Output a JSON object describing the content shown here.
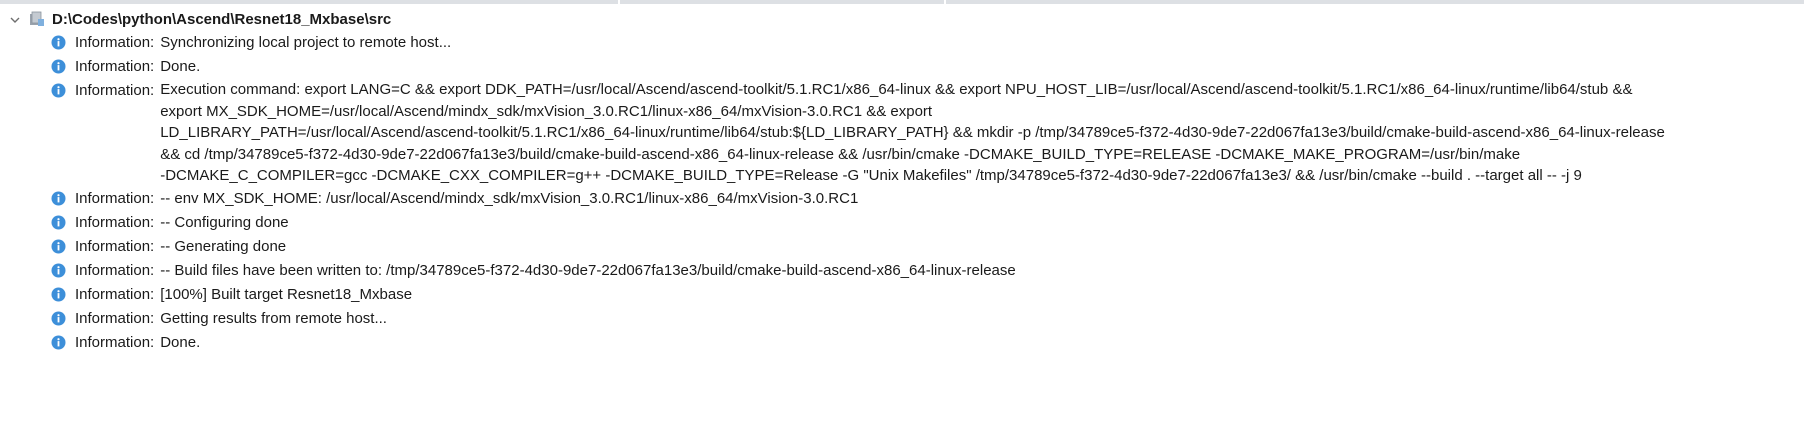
{
  "colors": {
    "info_icon": "#3d8fd9",
    "text": "#1a1a1a",
    "top_strip": "#dde0e4"
  },
  "icons": {
    "expand": "chevron-down-icon",
    "root": "folder-icon",
    "message": "info-icon"
  },
  "tree": {
    "root_label": "D:\\Codes\\python\\Ascend\\Resnet18_Mxbase\\src",
    "messages": [
      {
        "prefix": "Information:",
        "text": "Synchronizing local project to remote host..."
      },
      {
        "prefix": "Information:",
        "text": "Done."
      },
      {
        "prefix": "Information:",
        "lines": [
          "Execution command: export LANG=C && export DDK_PATH=/usr/local/Ascend/ascend-toolkit/5.1.RC1/x86_64-linux && export NPU_HOST_LIB=/usr/local/Ascend/ascend-toolkit/5.1.RC1/x86_64-linux/runtime/lib64/stub &&",
          "export MX_SDK_HOME=/usr/local/Ascend/mindx_sdk/mxVision_3.0.RC1/linux-x86_64/mxVision-3.0.RC1 && export",
          "LD_LIBRARY_PATH=/usr/local/Ascend/ascend-toolkit/5.1.RC1/x86_64-linux/runtime/lib64/stub:${LD_LIBRARY_PATH} && mkdir -p /tmp/34789ce5-f372-4d30-9de7-22d067fa13e3/build/cmake-build-ascend-x86_64-linux-release",
          "&& cd /tmp/34789ce5-f372-4d30-9de7-22d067fa13e3/build/cmake-build-ascend-x86_64-linux-release && /usr/bin/cmake -DCMAKE_BUILD_TYPE=RELEASE -DCMAKE_MAKE_PROGRAM=/usr/bin/make",
          "-DCMAKE_C_COMPILER=gcc -DCMAKE_CXX_COMPILER=g++ -DCMAKE_BUILD_TYPE=Release -G \"Unix Makefiles\" /tmp/34789ce5-f372-4d30-9de7-22d067fa13e3/ && /usr/bin/cmake --build . --target all -- -j 9"
        ]
      },
      {
        "prefix": "Information:",
        "text": "-- env MX_SDK_HOME: /usr/local/Ascend/mindx_sdk/mxVision_3.0.RC1/linux-x86_64/mxVision-3.0.RC1"
      },
      {
        "prefix": "Information:",
        "text": "-- Configuring done"
      },
      {
        "prefix": "Information:",
        "text": "-- Generating done"
      },
      {
        "prefix": "Information:",
        "text": "-- Build files have been written to: /tmp/34789ce5-f372-4d30-9de7-22d067fa13e3/build/cmake-build-ascend-x86_64-linux-release"
      },
      {
        "prefix": "Information:",
        "text": "[100%] Built target Resnet18_Mxbase"
      },
      {
        "prefix": "Information:",
        "text": "Getting results from remote host..."
      },
      {
        "prefix": "Information:",
        "text": "Done."
      }
    ]
  }
}
